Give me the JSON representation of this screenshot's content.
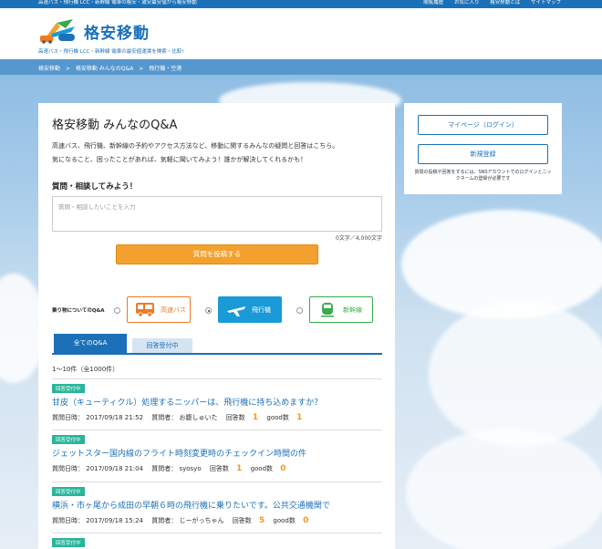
{
  "topbar": {
    "left_text": "高速バス・飛行機 LCC・新幹線 電車の格安・激安最安値から格安移動",
    "links": [
      "閲覧履歴",
      "お気に入り",
      "格安移動とは",
      "サイトマップ"
    ]
  },
  "header": {
    "logo_text": "格安移動",
    "tagline": "高速バス・飛行機 LCC・新幹線 電車の最安値運賃を検索・比較!"
  },
  "breadcrumb": {
    "home": "格安移動",
    "sep1": ">",
    "qa": "格安移動 みんなのQ&A",
    "sep2": ">",
    "current": "飛行機・空港"
  },
  "main": {
    "title": "格安移動 みんなのQ&A",
    "desc_line1": "高速バス、飛行機、新幹線の予約やアクセス方法など、移動に関するみんなの疑問と回答はこちら。",
    "desc_line2": "気になること、困ったことがあれば、気軽に聞いてみよう！誰かが解決してくれるかも！",
    "ask_title": "質問・相談してみよう！",
    "ask_placeholder": "質問・相談したいことを入力",
    "char_counter": "0文字／4,000文字",
    "post_button": "質問を投稿する",
    "transport_label": "乗り物についてのQ&A",
    "transports": [
      {
        "label": "高速バス",
        "icon": "bus-icon",
        "color": "#ee7a26"
      },
      {
        "label": "飛行機",
        "icon": "airplane-icon",
        "color": "#1a9ad6"
      },
      {
        "label": "新幹線",
        "icon": "shinkansen-icon",
        "color": "#3aab4c"
      }
    ],
    "tabs": [
      "全てのQ&A",
      "回答受付中"
    ],
    "result_count": "1〜10件（全1000件）",
    "questions": [
      {
        "badge": "回答受付中",
        "title": "甘皮（キューティクル）処理するニッパーは、飛行機に持ち込めますか？",
        "date_label": "質問日時：",
        "date": "2017/09/18 21:52",
        "asker_label": "質問者：",
        "asker": "お腹しゅいた",
        "answers_label": "回答数",
        "answers": "1",
        "good_label": "good数",
        "good": "1"
      },
      {
        "badge": "回答受付中",
        "title": "ジェットスター国内線のフライト時刻変更時のチェックイン時間の件",
        "date_label": "質問日時：",
        "date": "2017/09/18 21:04",
        "asker_label": "質問者：",
        "asker": "syosyo",
        "answers_label": "回答数",
        "answers": "1",
        "good_label": "good数",
        "good": "0"
      },
      {
        "badge": "回答受付中",
        "title": "横浜・市ヶ尾から成田の早朝６時の飛行機に乗りたいです。公共交通機関で",
        "date_label": "質問日時：",
        "date": "2017/09/18 15:24",
        "asker_label": "質問者：",
        "asker": "じーがっちゃん",
        "answers_label": "回答数",
        "answers": "5",
        "good_label": "good数",
        "good": "0"
      },
      {
        "badge": "回答受付中"
      }
    ]
  },
  "side": {
    "mypage_button": "マイページ（ログイン）",
    "register_button": "新規登録",
    "note": "質問の投稿や回答をするには、SNSアカウントでのログインとニックネームの登録が必要です"
  },
  "colors": {
    "brand": "#1b70b8",
    "accent_orange": "#f3a12e",
    "badge_green": "#29b59a"
  }
}
